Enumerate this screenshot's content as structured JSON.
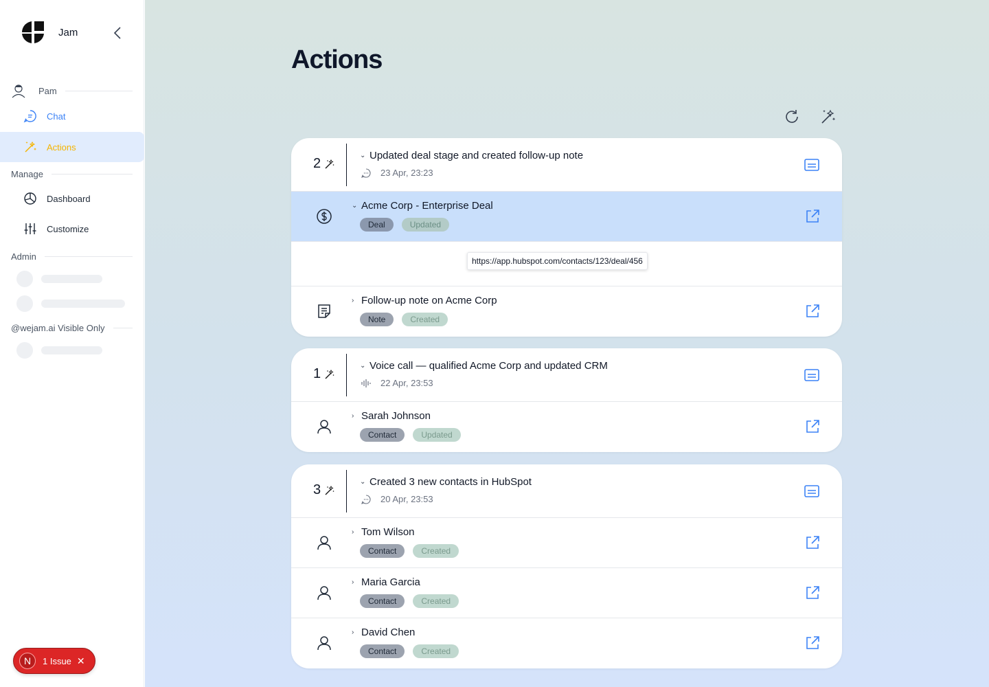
{
  "app": {
    "name": "Jam"
  },
  "sidebar": {
    "user_name": "Pam",
    "nav_chat": "Chat",
    "nav_actions": "Actions",
    "manage_label": "Manage",
    "nav_dashboard": "Dashboard",
    "nav_customize": "Customize",
    "admin_label": "Admin",
    "visible_label": "@wejam.ai Visible Only"
  },
  "issue": {
    "letter": "N",
    "label": "1 Issue"
  },
  "page": {
    "title": "Actions"
  },
  "colors": {
    "accent_blue": "#3b82f6",
    "active_yellow": "#f5b400",
    "highlight_row": "#c9dffb",
    "issue_red": "#dc2626"
  },
  "groups": [
    {
      "count": "2",
      "title": "Updated deal stage and created follow-up note",
      "timestamp": "23 Apr, 23:23",
      "source_icon": "chat-bubble-icon",
      "items": [
        {
          "icon": "dollar-icon",
          "title": "Acme Corp - Enterprise Deal",
          "type": "Deal",
          "status": "Updated",
          "tooltip": "https://app.hubspot.com/contacts/123/deal/456"
        },
        {
          "icon": "note-icon",
          "title": "Follow-up note on Acme Corp",
          "type": "Note",
          "status": "Created"
        }
      ]
    },
    {
      "count": "1",
      "title": "Voice call — qualified Acme Corp and updated CRM",
      "timestamp": "22 Apr, 23:53",
      "source_icon": "waveform-icon",
      "items": [
        {
          "icon": "person-icon",
          "title": "Sarah Johnson",
          "type": "Contact",
          "status": "Updated"
        }
      ]
    },
    {
      "count": "3",
      "title": "Created 3 new contacts in HubSpot",
      "timestamp": "20 Apr, 23:53",
      "source_icon": "chat-bubble-icon",
      "items": [
        {
          "icon": "person-icon",
          "title": "Tom Wilson",
          "type": "Contact",
          "status": "Created"
        },
        {
          "icon": "person-icon",
          "title": "Maria Garcia",
          "type": "Contact",
          "status": "Created"
        },
        {
          "icon": "person-icon",
          "title": "David Chen",
          "type": "Contact",
          "status": "Created"
        }
      ]
    }
  ]
}
